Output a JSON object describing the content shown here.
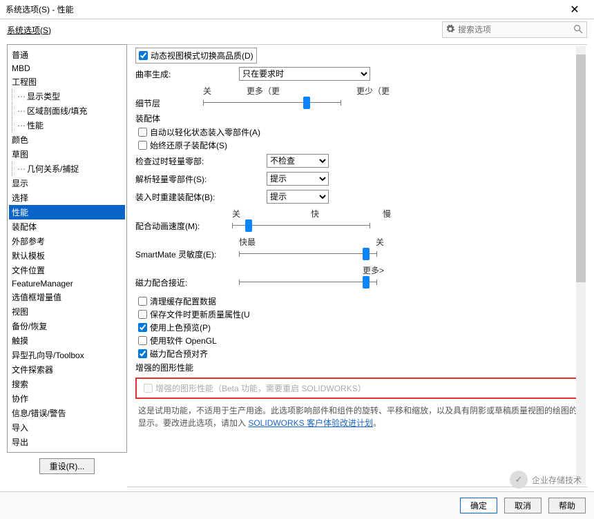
{
  "window": {
    "title": "系统选项(S) - 性能",
    "close": "✕"
  },
  "tab": "系统选项(S)",
  "search": {
    "placeholder": "搜索选项"
  },
  "tree": {
    "items": [
      {
        "label": "普通",
        "lvl": 1
      },
      {
        "label": "MBD",
        "lvl": 1
      },
      {
        "label": "工程图",
        "lvl": 1
      },
      {
        "label": "显示类型",
        "lvl": 2
      },
      {
        "label": "区域剖面线/填充",
        "lvl": 2
      },
      {
        "label": "性能",
        "lvl": 2
      },
      {
        "label": "颜色",
        "lvl": 1
      },
      {
        "label": "草图",
        "lvl": 1
      },
      {
        "label": "几何关系/捕捉",
        "lvl": 2
      },
      {
        "label": "显示",
        "lvl": 1
      },
      {
        "label": "选择",
        "lvl": 1
      },
      {
        "label": "性能",
        "lvl": 1,
        "selected": true
      },
      {
        "label": "装配体",
        "lvl": 1
      },
      {
        "label": "外部参考",
        "lvl": 1
      },
      {
        "label": "默认模板",
        "lvl": 1
      },
      {
        "label": "文件位置",
        "lvl": 1
      },
      {
        "label": "FeatureManager",
        "lvl": 1
      },
      {
        "label": "选值框增量值",
        "lvl": 1
      },
      {
        "label": "视图",
        "lvl": 1
      },
      {
        "label": "备份/恢复",
        "lvl": 1
      },
      {
        "label": "触摸",
        "lvl": 1
      },
      {
        "label": "异型孔向导/Toolbox",
        "lvl": 1
      },
      {
        "label": "文件探索器",
        "lvl": 1
      },
      {
        "label": "搜索",
        "lvl": 1
      },
      {
        "label": "协作",
        "lvl": 1
      },
      {
        "label": "信息/错误/警告",
        "lvl": 1
      },
      {
        "label": "导入",
        "lvl": 1
      },
      {
        "label": "导出",
        "lvl": 1
      }
    ],
    "reset": "重设(R)..."
  },
  "content": {
    "cutoff_checkbox": "动态视图模式切换高品质(D)",
    "curvature": {
      "label": "曲率生成:",
      "value": "只在要求时"
    },
    "detail": {
      "label": "细节层",
      "slider_labels": {
        "off": "关",
        "more": "更多（更",
        "less": "更少（更"
      },
      "value_pct": 75
    },
    "assembly": {
      "group": "装配体",
      "chk1": "自动以轻化状态装入零部件(A)",
      "chk2": "始终还原子装配体(S)",
      "row1": {
        "label": "检查过时轻量零部:",
        "value": "不检查"
      },
      "row2": {
        "label": "解析轻量零部件(S):",
        "value": "提示"
      },
      "row3": {
        "label": "装入时重建装配体(B):",
        "value": "提示"
      },
      "slider1": {
        "label": "配合动画速度(M):",
        "labels": {
          "off": "关",
          "fast": "快",
          "slow": "慢"
        },
        "value_pct": 12
      },
      "slider2": {
        "label": "SmartMate 灵敏度(E):",
        "labels": {
          "fastest": "快最",
          "off": "关"
        },
        "value_pct": 92
      },
      "slider3": {
        "label": "磁力配合接近:",
        "labels": {
          "off": "",
          "more": "更多>"
        },
        "value_pct": 92
      }
    },
    "checks": {
      "c1": "清理缓存配置数据",
      "c2": "保存文件时更新质量属性(U",
      "c3": "使用上色预览(P)",
      "c4": "使用软件 OpenGL",
      "c5": "磁力配合预对齐"
    },
    "enhanced": {
      "group": "增强的图形性能",
      "beta": "增强的图形性能（Beta 功能，需要重启 SOLIDWORKS）",
      "desc": "这是试用功能，不适用于生产用途。此选项影响部件和组件的旋转、平移和缩放，以及具有阴影或草稿质量视图的绘图的显示。要改进此选项，请加入 ",
      "link": "SOLIDWORKS 客户体验改进计划",
      "desc_end": "。"
    }
  },
  "footer": {
    "ok": "确定",
    "cancel": "取消",
    "help": "帮助"
  },
  "watermark": "企业存储技术"
}
